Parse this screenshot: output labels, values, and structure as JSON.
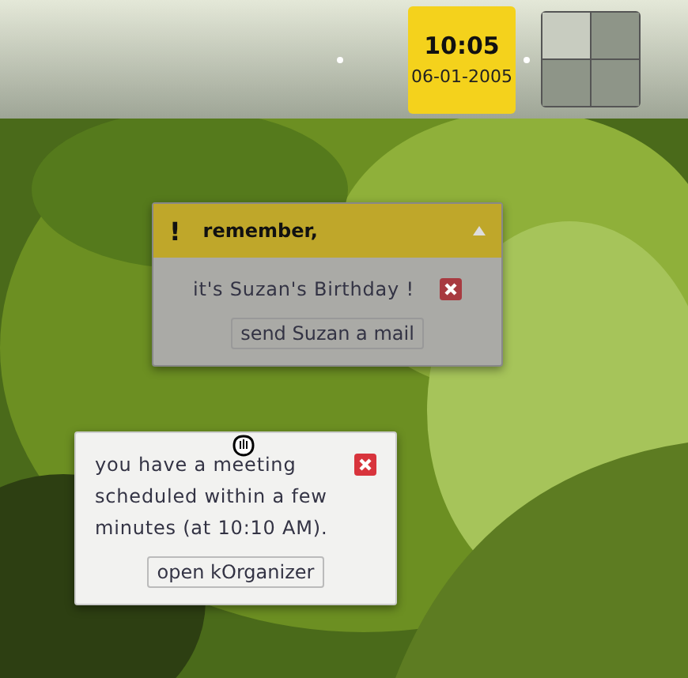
{
  "panel": {
    "time": "10:05",
    "date": "06-01-2005",
    "desktops": [
      {
        "selected": true
      },
      {
        "selected": false
      },
      {
        "selected": false
      },
      {
        "selected": false
      }
    ]
  },
  "popups": [
    {
      "kind": "titled",
      "dimmed": true,
      "title": "remember,",
      "mark": "!",
      "message": "it's Suzan's Birthday !",
      "action": "send Suzan a mail"
    },
    {
      "kind": "plain",
      "dimmed": false,
      "message": "you have a meeting scheduled within a few minutes (at 10:10 AM).",
      "action": "open kOrganizer"
    }
  ]
}
